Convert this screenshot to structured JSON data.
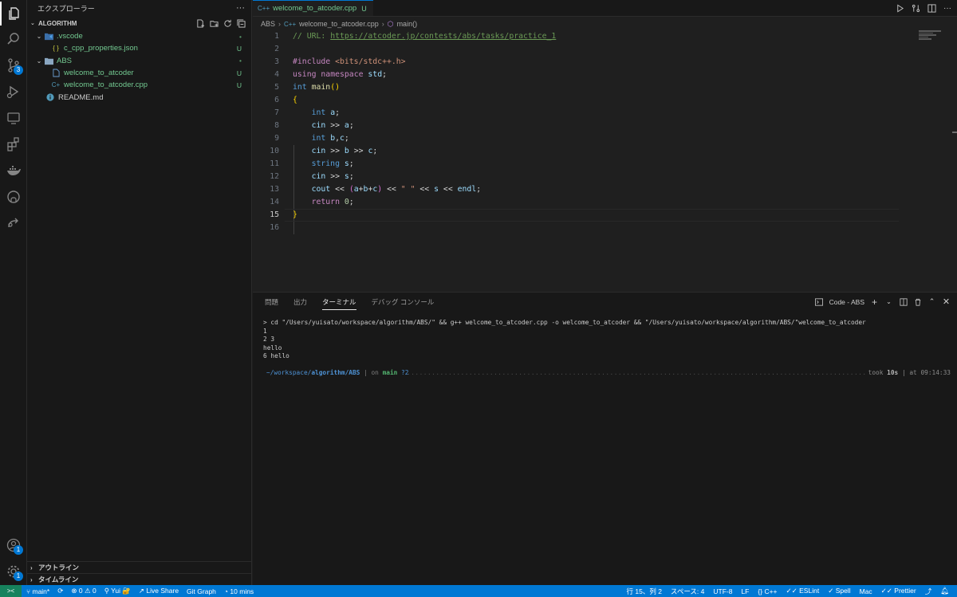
{
  "sidebar": {
    "title": "エクスプローラー",
    "more": "···",
    "section": "ALGORITHM",
    "tree": [
      {
        "label": ".vscode",
        "status": "•",
        "indent": 1,
        "kind": "folder"
      },
      {
        "label": "c_cpp_properties.json",
        "status": "U",
        "indent": 2,
        "kind": "json"
      },
      {
        "label": "ABS",
        "status": "•",
        "indent": 1,
        "kind": "folder"
      },
      {
        "label": "welcome_to_atcoder",
        "status": "U",
        "indent": 2,
        "kind": "file"
      },
      {
        "label": "welcome_to_atcoder.cpp",
        "status": "U",
        "indent": 2,
        "kind": "cpp"
      },
      {
        "label": "README.md",
        "status": "",
        "indent": 1,
        "kind": "info"
      }
    ],
    "outline": "アウトライン",
    "timeline": "タイムライン"
  },
  "activity": {
    "scm_badge": "3",
    "accounts_badge": "1",
    "settings_badge": "1"
  },
  "editor": {
    "tab": {
      "icon": "C++",
      "title": "welcome_to_atcoder.cpp",
      "status": "U",
      "close": "×"
    },
    "breadcrumb": {
      "folder": "ABS",
      "icon": "C++",
      "file": "welcome_to_atcoder.cpp",
      "symbol": "main()"
    },
    "current_line": 15,
    "lines": [
      "// URL: https://atcoder.jp/contests/abs/tasks/practice_1",
      "",
      "#include <bits/stdc++.h>",
      "using namespace std;",
      "int main()",
      "{",
      "    int a;",
      "    cin >> a;",
      "    int b,c;",
      "    cin >> b >> c;",
      "    string s;",
      "    cin >> s;",
      "    cout << (a+b+c) << \" \" << s << endl;",
      "    return 0;",
      "}",
      ""
    ]
  },
  "panel": {
    "tabs": [
      "問題",
      "出力",
      "ターミナル",
      "デバッグ コンソール"
    ],
    "active_tab": "ターミナル",
    "terminal_name": "Code - ABS",
    "terminal": {
      "command": "> cd \"/Users/yuisato/workspace/algorithm/ABS/\" && g++ welcome_to_atcoder.cpp -o welcome_to_atcoder && \"/Users/yuisato/workspace/algorithm/ABS/\"welcome_to_atcoder",
      "output": [
        "1",
        "2 3",
        "hello",
        "6 hello"
      ],
      "prompt_path_prefix": "~/workspace/",
      "prompt_path_bold": "algorithm/ABS",
      "prompt_on": "| on",
      "prompt_branch": "main",
      "prompt_changes": "?2",
      "prompt_dots": "............................................................................................................................................................................................................................................................",
      "prompt_took": "took",
      "prompt_duration": "10s",
      "prompt_at": "| at",
      "prompt_time": "09:14:33",
      "input_prompt": ">"
    }
  },
  "statusbar": {
    "remote": "><",
    "branch": "main*",
    "sync": "⟳",
    "errors": "0",
    "warnings": "0",
    "user": "Yui 🔐",
    "live_share": "Live Share",
    "git_graph": "Git Graph",
    "timer": "10 mins",
    "position": "行 15、列 2",
    "spaces": "スペース: 4",
    "encoding": "UTF-8",
    "eol": "LF",
    "language": "C++",
    "eslint": "ESLint",
    "spell": "Spell",
    "mac": "Mac",
    "prettier": "Prettier"
  },
  "colors": {
    "accent": "#0078d4",
    "untracked": "#73c991",
    "remote": "#16825d"
  }
}
